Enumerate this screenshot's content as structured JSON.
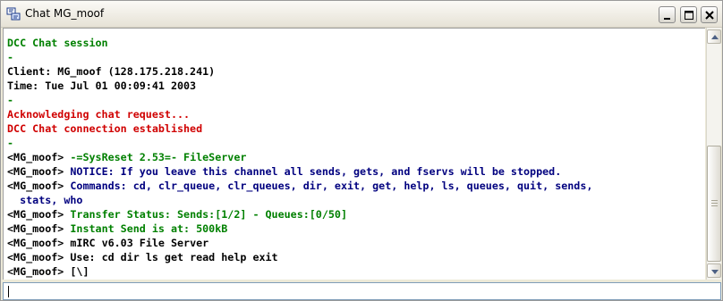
{
  "window": {
    "title": "Chat MG_moof",
    "icon": "mirc-chat-icon",
    "controls": {
      "minimize": "minimize-icon",
      "maximize": "maximize-icon",
      "close": "close-icon"
    }
  },
  "colors": {
    "system": "#008000",
    "info": "#000000",
    "alert": "#D00000",
    "navy": "#00007F"
  },
  "chat": {
    "lines": [
      {
        "text": "DCC Chat session",
        "color": "system"
      },
      {
        "text": "-",
        "color": "system"
      },
      {
        "text": "Client: MG_moof (128.175.218.241)",
        "color": "info"
      },
      {
        "text": "Time: Tue Jul 01 00:09:41 2003",
        "color": "info"
      },
      {
        "text": "-",
        "color": "system"
      },
      {
        "text": "Acknowledging chat request...",
        "color": "alert"
      },
      {
        "text": "DCC Chat connection established",
        "color": "alert"
      },
      {
        "text": "-",
        "color": "system"
      },
      {
        "nick": "<MG_moof>",
        "text": " -=SysReset 2.53=- FileServer",
        "color": "green"
      },
      {
        "nick": "<MG_moof>",
        "text": " NOTICE: If you leave this channel all sends, gets, and fservs will be stopped.",
        "color": "navy"
      },
      {
        "nick": "<MG_moof>",
        "text": " Commands: cd, clr_queue, clr_queues, dir, exit, get, help, ls, queues, quit, sends,",
        "text2": "  stats, who",
        "color": "navy"
      },
      {
        "nick": "<MG_moof>",
        "text": " Transfer Status: Sends:[1/2] - Queues:[0/50]",
        "color": "green"
      },
      {
        "nick": "<MG_moof>",
        "text": " Instant Send is at: 500kB",
        "color": "green"
      },
      {
        "nick": "<MG_moof>",
        "text": " mIRC v6.03 File Server",
        "color": "info"
      },
      {
        "nick": "<MG_moof>",
        "text": " Use: cd dir ls get read help exit",
        "color": "info"
      },
      {
        "nick": "<MG_moof>",
        "text": " [\\]",
        "color": "info"
      }
    ]
  },
  "input": {
    "value": "",
    "placeholder": ""
  },
  "scrollbar": {
    "up": "scroll-up-icon",
    "down": "scroll-down-icon"
  }
}
